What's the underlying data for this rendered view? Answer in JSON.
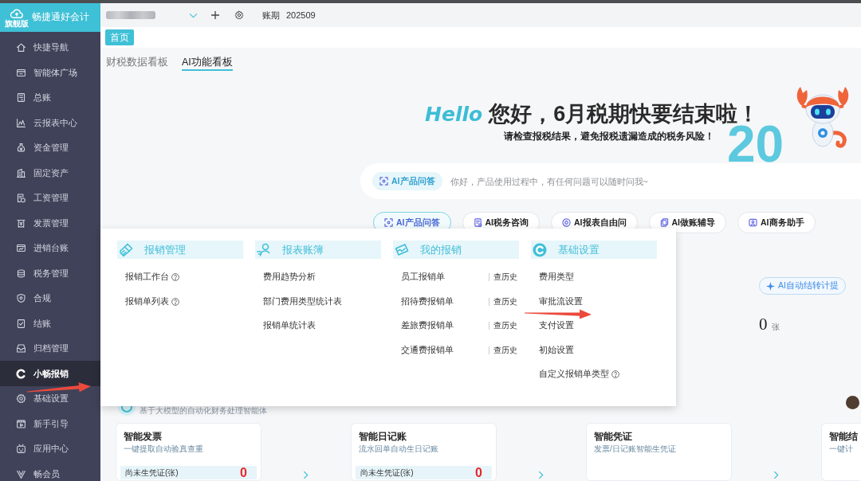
{
  "app": {
    "name": "畅捷通好会计",
    "edition": "旗舰版"
  },
  "sidebar": {
    "items": [
      {
        "label": "快捷导航",
        "selected": false
      },
      {
        "label": "智能体广场",
        "selected": false
      },
      {
        "label": "总账",
        "selected": false
      },
      {
        "label": "云报表中心",
        "selected": false
      },
      {
        "label": "资金管理",
        "selected": false
      },
      {
        "label": "固定资产",
        "selected": false
      },
      {
        "label": "工资管理",
        "selected": false
      },
      {
        "label": "发票管理",
        "selected": false
      },
      {
        "label": "进销台账",
        "selected": false
      },
      {
        "label": "税务管理",
        "selected": false
      },
      {
        "label": "合规",
        "selected": false
      },
      {
        "label": "结账",
        "selected": false
      },
      {
        "label": "归档管理",
        "selected": false
      },
      {
        "label": "小畅报销",
        "selected": true
      },
      {
        "label": "基础设置",
        "selected": false
      },
      {
        "label": "新手引导",
        "selected": false
      },
      {
        "label": "应用中心",
        "selected": false
      },
      {
        "label": "畅会员",
        "selected": false
      }
    ]
  },
  "top_bar": {
    "period_label": "账期",
    "period": "202509"
  },
  "page_tabs": [
    {
      "label": "首页",
      "selected": true
    }
  ],
  "board_tabs": [
    {
      "label": "财税数据看板",
      "selected": false
    },
    {
      "label": "AI功能看板",
      "selected": true
    }
  ],
  "hero": {
    "greeting": "Hello",
    "title": "您好，6月税期快要结束啦！",
    "subtitle": "请检查报税结果，避免报税遗漏造成的税务风险！",
    "year": "20"
  },
  "assistant": {
    "mode": "AI产品问答",
    "placeholder": "你好，产品使用过程中，有任何问题可以随时问我~",
    "tabs": [
      {
        "label": "AI产品问答",
        "selected": true
      },
      {
        "label": "AI税务咨询",
        "selected": false
      },
      {
        "label": "AI报表自由问",
        "selected": false
      },
      {
        "label": "AI做账辅导",
        "selected": false
      },
      {
        "label": "AI商务助手",
        "selected": false
      }
    ]
  },
  "carryover": {
    "button": "AI自动结转计提",
    "count": "0",
    "unit": "张"
  },
  "agents": {
    "subtitle": "基于大模型的自动化财务处理智能体",
    "cards": [
      {
        "title": "智能发票",
        "subtitle": "一键提取自动验真查重",
        "stat_label": "尚未生凭证(张)",
        "stat_value": "0"
      },
      {
        "title": "智能日记账",
        "subtitle": "流水回单自动生日记账",
        "stat_label": "尚未生凭证(张)",
        "stat_value": "0"
      },
      {
        "title": "智能凭证",
        "subtitle": "发票/日记账智能生凭证"
      },
      {
        "title": "智能结",
        "subtitle": "一键计"
      }
    ]
  },
  "popup_menu": {
    "columns": [
      {
        "title": "报销管理",
        "items": [
          {
            "label": "报销工作台",
            "help": true
          },
          {
            "label": "报销单列表",
            "help": true
          }
        ]
      },
      {
        "title": "报表账簿",
        "items": [
          {
            "label": "费用趋势分析",
            "help": false
          },
          {
            "label": "部门费用类型统计表",
            "help": false
          },
          {
            "label": "报销单统计表",
            "help": false
          }
        ]
      },
      {
        "title": "我的报销",
        "items": [
          {
            "label": "员工报销单",
            "help": false,
            "history": "查历史"
          },
          {
            "label": "招待费报销单",
            "help": false,
            "history": "查历史"
          },
          {
            "label": "差旅费报销单",
            "help": false,
            "history": "查历史"
          },
          {
            "label": "交通费报销单",
            "help": false,
            "history": "查历史"
          }
        ]
      },
      {
        "title": "基础设置",
        "items": [
          {
            "label": "费用类型",
            "help": false
          },
          {
            "label": "审批流设置",
            "help": false
          },
          {
            "label": "支付设置",
            "help": false
          },
          {
            "label": "初始设置",
            "help": false
          },
          {
            "label": "自定义报销单类型",
            "help": true
          }
        ]
      }
    ]
  }
}
